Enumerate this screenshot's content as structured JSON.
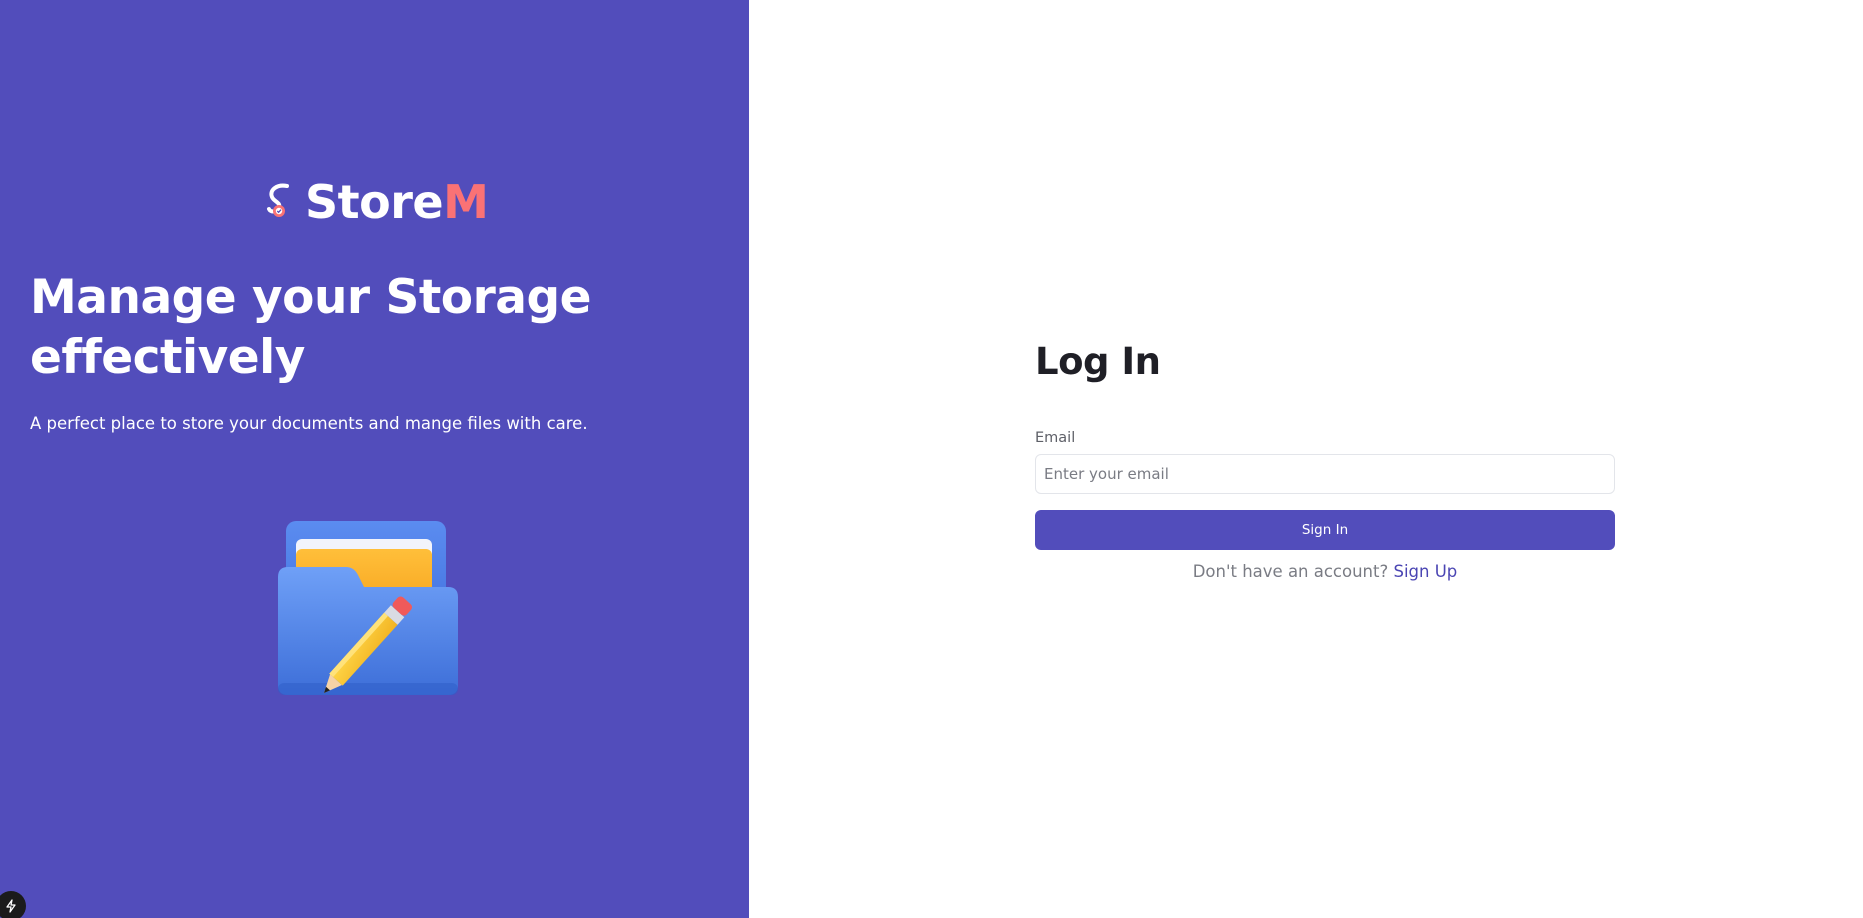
{
  "brand": {
    "name_main": "Store",
    "name_accent": "M",
    "logo_icon": "storem-logo-icon"
  },
  "hero": {
    "title_line1": "Manage your Storage",
    "title_line2": "effectively",
    "subtitle": "A perfect place to store your documents and mange files with care.",
    "illustration": "folder-with-pencil-illustration"
  },
  "login": {
    "title": "Log In",
    "email_label": "Email",
    "email_placeholder": "Enter your email",
    "email_value": "",
    "submit_label": "Sign In",
    "switch_prompt": "Don't have an account?",
    "switch_link": "Sign Up"
  },
  "corner_badge": {
    "icon": "lightning-icon"
  },
  "colors": {
    "brand_primary": "#524dbb",
    "brand_accent": "#fa7275",
    "text_dark": "#1f1f26",
    "text_muted": "#7a7c84"
  }
}
